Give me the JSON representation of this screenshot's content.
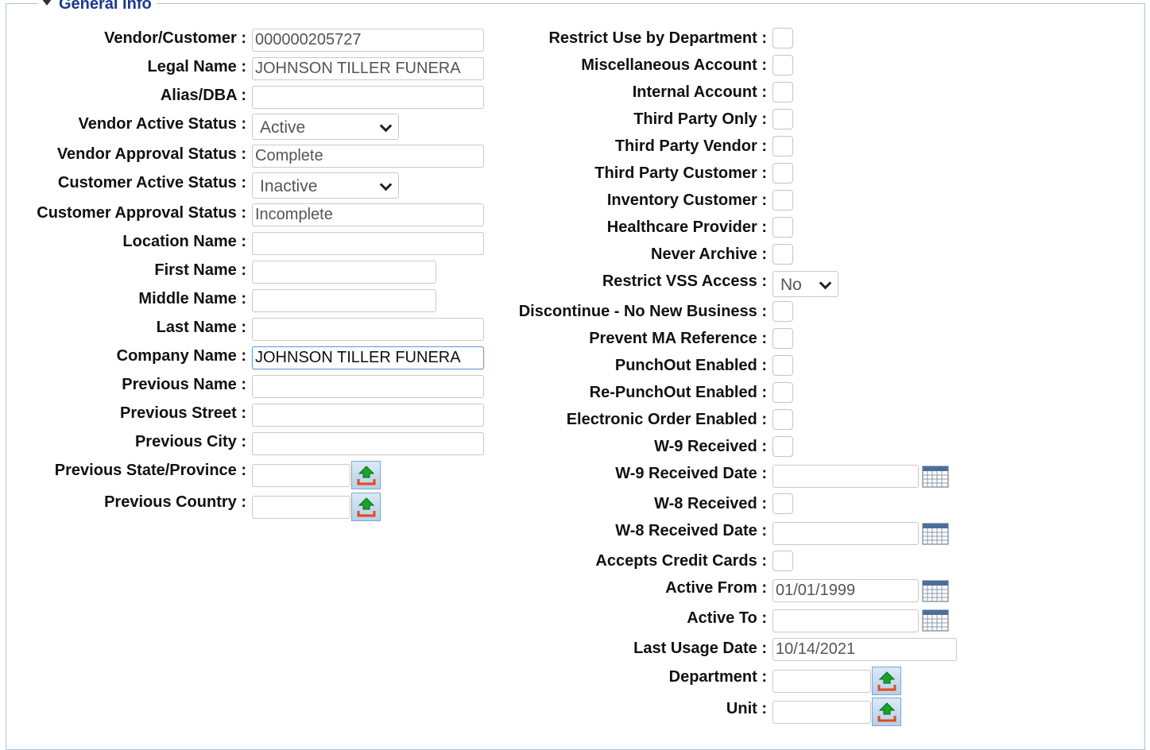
{
  "section": {
    "title": "General Info"
  },
  "left": {
    "vendor_customer": {
      "label": "Vendor/Customer :",
      "value": "000000205727"
    },
    "legal_name": {
      "label": "Legal Name :",
      "value": "JOHNSON TILLER FUNERA"
    },
    "alias_dba": {
      "label": "Alias/DBA :",
      "value": ""
    },
    "vendor_active_status": {
      "label": "Vendor Active Status :",
      "value": "Active"
    },
    "vendor_approval_status": {
      "label": "Vendor Approval Status :",
      "value": "Complete"
    },
    "customer_active_status": {
      "label": "Customer Active Status :",
      "value": "Inactive"
    },
    "customer_approval_status": {
      "label": "Customer Approval Status :",
      "value": "Incomplete"
    },
    "location_name": {
      "label": "Location Name :",
      "value": ""
    },
    "first_name": {
      "label": "First Name :",
      "value": ""
    },
    "middle_name": {
      "label": "Middle Name :",
      "value": ""
    },
    "last_name": {
      "label": "Last Name :",
      "value": ""
    },
    "company_name": {
      "label": "Company Name :",
      "value": "JOHNSON TILLER FUNERA"
    },
    "previous_name": {
      "label": "Previous Name :",
      "value": ""
    },
    "previous_street": {
      "label": "Previous Street :",
      "value": ""
    },
    "previous_city": {
      "label": "Previous City :",
      "value": ""
    },
    "previous_state": {
      "label": "Previous State/Province :",
      "value": ""
    },
    "previous_country": {
      "label": "Previous Country :",
      "value": ""
    }
  },
  "right": {
    "restrict_use_by_department": {
      "label": "Restrict Use by Department :",
      "checked": false
    },
    "miscellaneous_account": {
      "label": "Miscellaneous Account :",
      "checked": false
    },
    "internal_account": {
      "label": "Internal Account :",
      "checked": false
    },
    "third_party_only": {
      "label": "Third Party Only :",
      "checked": false
    },
    "third_party_vendor": {
      "label": "Third Party Vendor :",
      "checked": false
    },
    "third_party_customer": {
      "label": "Third Party Customer :",
      "checked": false
    },
    "inventory_customer": {
      "label": "Inventory Customer :",
      "checked": false
    },
    "healthcare_provider": {
      "label": "Healthcare Provider :",
      "checked": false
    },
    "never_archive": {
      "label": "Never Archive :",
      "checked": false
    },
    "restrict_vss_access": {
      "label": "Restrict VSS Access :",
      "value": "No"
    },
    "discontinue": {
      "label": "Discontinue - No New Business :",
      "checked": false
    },
    "prevent_ma_reference": {
      "label": "Prevent MA Reference :",
      "checked": false
    },
    "punchout_enabled": {
      "label": "PunchOut Enabled :",
      "checked": false
    },
    "repunchout_enabled": {
      "label": "Re-PunchOut Enabled :",
      "checked": false
    },
    "electronic_order_enabled": {
      "label": "Electronic Order Enabled :",
      "checked": false
    },
    "w9_received": {
      "label": "W-9 Received :",
      "checked": false
    },
    "w9_received_date": {
      "label": "W-9 Received Date :",
      "value": ""
    },
    "w8_received": {
      "label": "W-8 Received :",
      "checked": false
    },
    "w8_received_date": {
      "label": "W-8 Received Date :",
      "value": ""
    },
    "accepts_credit_cards": {
      "label": "Accepts Credit Cards :",
      "checked": false
    },
    "active_from": {
      "label": "Active From :",
      "value": "01/01/1999"
    },
    "active_to": {
      "label": "Active To :",
      "value": ""
    },
    "last_usage_date": {
      "label": "Last Usage Date :",
      "value": "10/14/2021"
    },
    "department": {
      "label": "Department :",
      "value": ""
    },
    "unit": {
      "label": "Unit :",
      "value": ""
    }
  },
  "icons": {
    "lookup": "upload-arrow-icon",
    "calendar": "calendar-icon",
    "dropdown": "chevron-down-icon"
  }
}
